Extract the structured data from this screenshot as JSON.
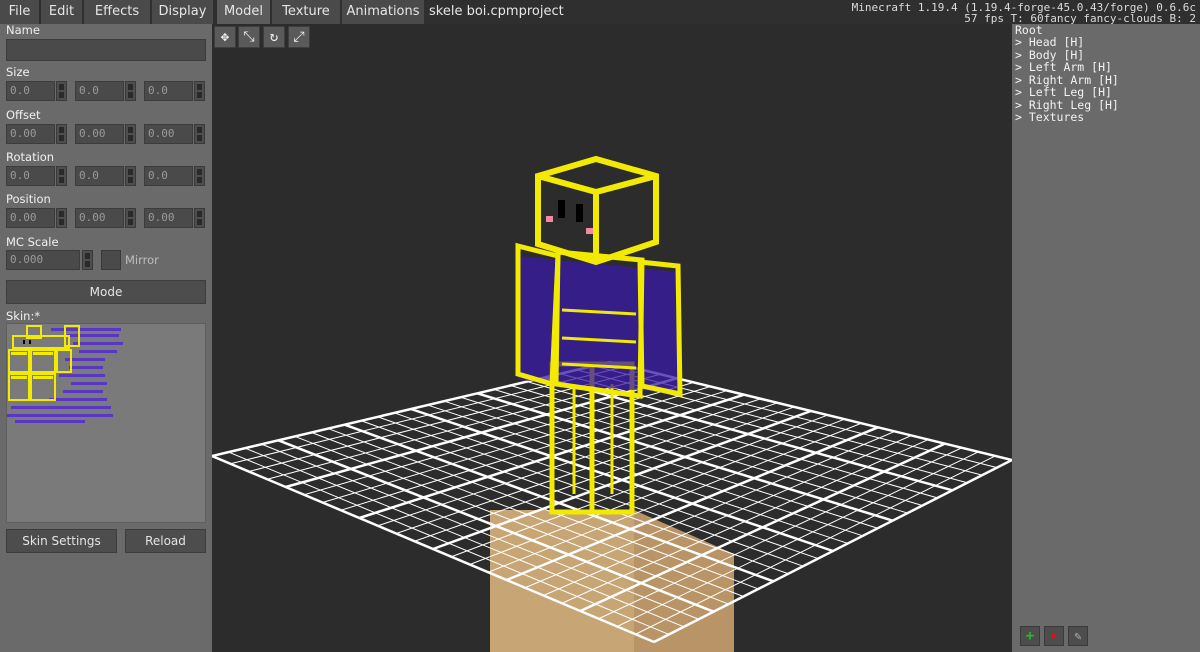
{
  "menu": {
    "file": "File",
    "edit": "Edit",
    "effects": "Effects",
    "display": "Display",
    "model": "Model",
    "texture": "Texture",
    "animations": "Animations"
  },
  "project_title": "skele boi.cpmproject",
  "status": {
    "version": "Minecraft 1.19.4 (1.19.4-forge-45.0.43/forge) 0.6.6c",
    "fps": "57 fps T: 60fancy fancy-clouds B: 2"
  },
  "left_panel": {
    "name_label": "Name",
    "name_value": "",
    "size_label": "Size",
    "size_values": [
      "0.0",
      "0.0",
      "0.0"
    ],
    "offset_label": "Offset",
    "offset_values": [
      "0.00",
      "0.00",
      "0.00"
    ],
    "rotation_label": "Rotation",
    "rotation_values": [
      "0.0",
      "0.0",
      "0.0"
    ],
    "position_label": "Position",
    "position_values": [
      "0.00",
      "0.00",
      "0.00"
    ],
    "mc_scale_label": "MC Scale",
    "mc_scale_value": "0.000",
    "mirror_label": "Mirror",
    "mode_button": "Mode",
    "skin_label": "Skin:*",
    "skin_settings_button": "Skin Settings",
    "reload_button": "Reload"
  },
  "tools": [
    "move-icon",
    "resize-icon",
    "rotate-icon",
    "scale-icon"
  ],
  "tree": {
    "root": "Root",
    "items": [
      "> Head [H]",
      "> Body [H]",
      "> Left Arm [H]",
      "> Right Arm [H]",
      "> Left Leg [H]",
      "> Right Leg [H]",
      "> Textures"
    ]
  },
  "tree_buttons": {
    "add": "+",
    "delete": "✖",
    "edit": "✎"
  },
  "colors": {
    "outline": "#f2ea00",
    "body_fill": "#3a1aa8",
    "grid": "#ffffff",
    "block": "#c8a06a",
    "add": "#1fc01f",
    "delete": "#d01818"
  }
}
